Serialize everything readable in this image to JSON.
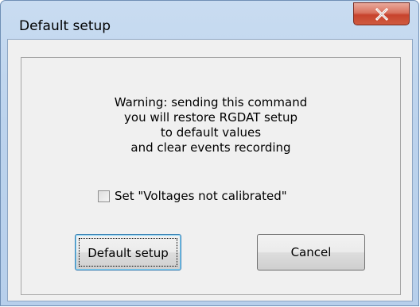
{
  "window": {
    "title": "Default setup",
    "close_icon": "close-icon"
  },
  "dialog": {
    "warning_lines": [
      "Warning: sending this command",
      "you will restore RGDAT setup",
      "to default values",
      "and clear events recording"
    ],
    "checkbox_label": "Set \"Voltages not calibrated\"",
    "checkbox_checked": false,
    "default_button_label": "Default setup",
    "cancel_button_label": "Cancel"
  },
  "colors": {
    "close_button": "#c7432d",
    "title_bar": "#c9dcf1",
    "client_background": "#f0f0f0"
  }
}
